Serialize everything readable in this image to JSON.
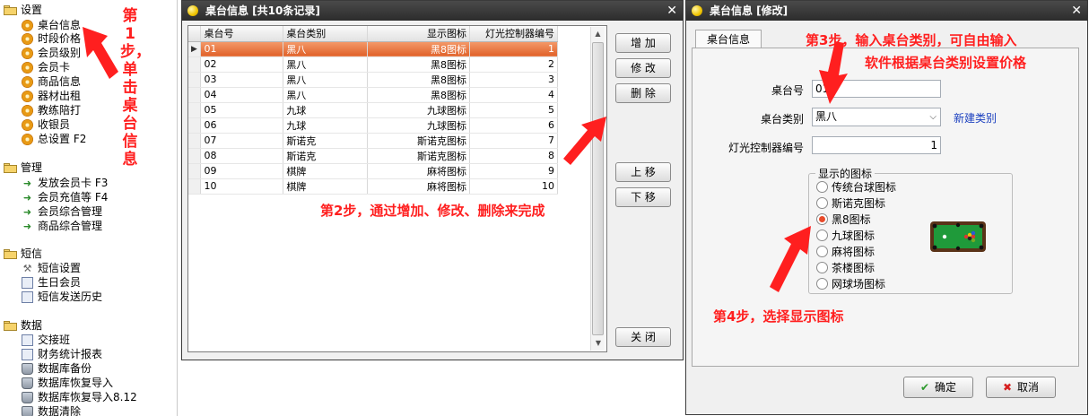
{
  "sidebar": {
    "groups": [
      {
        "label": "设置",
        "items": [
          "桌台信息",
          "时段价格",
          "会员级别",
          "会员卡",
          "商品信息",
          "器材出租",
          "教练陪打",
          "收银员",
          "总设置 F2"
        ]
      },
      {
        "label": "管理",
        "items": [
          "发放会员卡 F3",
          "会员充值等 F4",
          "会员综合管理",
          "商品综合管理"
        ]
      },
      {
        "label": "短信",
        "items": [
          "短信设置",
          "生日会员",
          "短信发送历史"
        ]
      },
      {
        "label": "数据",
        "items": [
          "交接班",
          "财务统计报表",
          "数据库备份",
          "数据库恢复导入",
          "数据库恢复导入8.12",
          "数据清除"
        ]
      }
    ]
  },
  "annotations": {
    "step1": "第1步，单击桌台信息",
    "step2": "第2步，通过增加、修改、删除来完成",
    "step3_line1": "第3步，输入桌台类别，可自由输入",
    "step3_line2": "软件根据桌台类别设置价格",
    "step4": "第4步，选择显示图标"
  },
  "list_window": {
    "title": "桌台信息 [共10条记录]",
    "columns": [
      "桌台号",
      "桌台类别",
      "显示图标",
      "灯光控制器编号"
    ],
    "rows": [
      [
        "01",
        "黑八",
        "黑8图标",
        "1"
      ],
      [
        "02",
        "黑八",
        "黑8图标",
        "2"
      ],
      [
        "03",
        "黑八",
        "黑8图标",
        "3"
      ],
      [
        "04",
        "黑八",
        "黑8图标",
        "4"
      ],
      [
        "05",
        "九球",
        "九球图标",
        "5"
      ],
      [
        "06",
        "九球",
        "九球图标",
        "6"
      ],
      [
        "07",
        "斯诺克",
        "斯诺克图标",
        "7"
      ],
      [
        "08",
        "斯诺克",
        "斯诺克图标",
        "8"
      ],
      [
        "09",
        "棋牌",
        "麻将图标",
        "9"
      ],
      [
        "10",
        "棋牌",
        "麻将图标",
        "10"
      ]
    ],
    "buttons": {
      "add": "增 加",
      "edit": "修 改",
      "delete": "删 除",
      "up": "上 移",
      "down": "下 移",
      "close": "关 闭"
    }
  },
  "edit_window": {
    "title": "桌台信息 [修改]",
    "tab": "桌台信息",
    "table_no_label": "桌台号",
    "table_no_value": "01",
    "category_label": "桌台类别",
    "category_value": "黑八",
    "new_category_link": "新建类别",
    "light_label": "灯光控制器编号",
    "light_value": "1",
    "icon_group_label": "显示的图标",
    "icon_options": [
      "传统台球图标",
      "斯诺克图标",
      "黑8图标",
      "九球图标",
      "麻将图标",
      "茶楼图标",
      "网球场图标"
    ],
    "selected_icon": "黑8图标",
    "ok": "确定",
    "cancel": "取消"
  }
}
